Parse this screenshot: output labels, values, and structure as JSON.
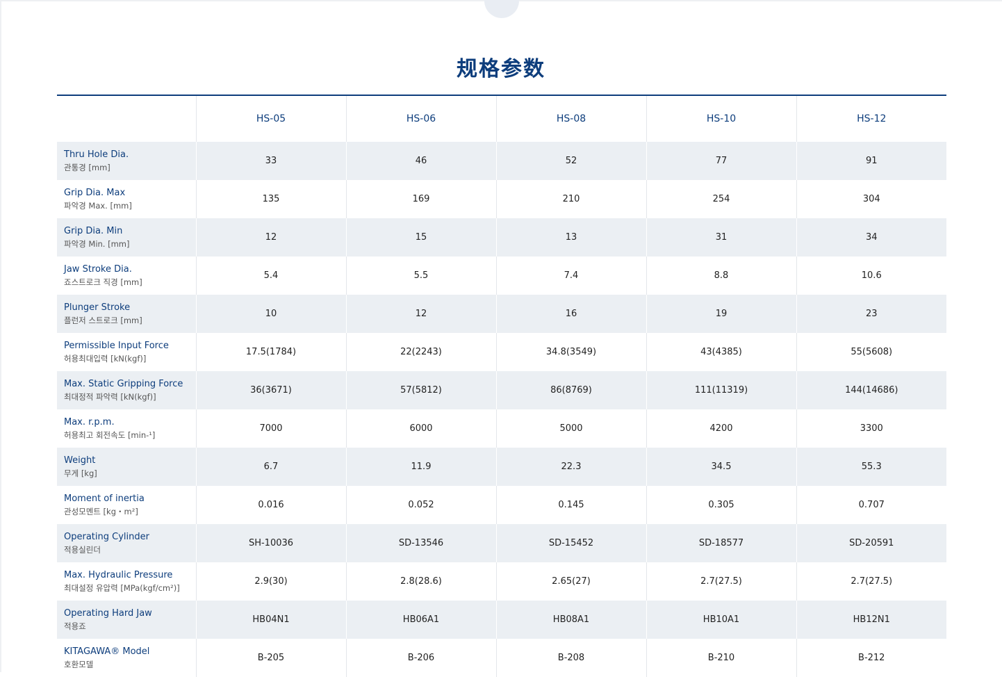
{
  "section": {
    "title": "规格参数"
  },
  "table": {
    "models": [
      "HS-05",
      "HS-06",
      "HS-08",
      "HS-10",
      "HS-12"
    ],
    "rows": [
      {
        "en": "Thru Hole Dia.",
        "ko": "관통경 [mm]",
        "values": [
          "33",
          "46",
          "52",
          "77",
          "91"
        ]
      },
      {
        "en": "Grip Dia. Max",
        "ko": "파악경 Max. [mm]",
        "values": [
          "135",
          "169",
          "210",
          "254",
          "304"
        ]
      },
      {
        "en": "Grip Dia. Min",
        "ko": "파악경 Min. [mm]",
        "values": [
          "12",
          "15",
          "13",
          "31",
          "34"
        ]
      },
      {
        "en": "Jaw Stroke Dia.",
        "ko": "죠스트로크 직경 [mm]",
        "values": [
          "5.4",
          "5.5",
          "7.4",
          "8.8",
          "10.6"
        ]
      },
      {
        "en": "Plunger Stroke",
        "ko": "플런저 스트로크 [mm]",
        "values": [
          "10",
          "12",
          "16",
          "19",
          "23"
        ]
      },
      {
        "en": "Permissible Input Force",
        "ko": "허용최대입력 [kN(kgf)]",
        "values": [
          "17.5(1784)",
          "22(2243)",
          "34.8(3549)",
          "43(4385)",
          "55(5608)"
        ]
      },
      {
        "en": "Max. Static Gripping Force",
        "ko": "최대정적 파악력 [kN(kgf)]",
        "values": [
          "36(3671)",
          "57(5812)",
          "86(8769)",
          "111(11319)",
          "144(14686)"
        ]
      },
      {
        "en": "Max. r.p.m.",
        "ko": "허용최고 회전속도 [min-¹]",
        "values": [
          "7000",
          "6000",
          "5000",
          "4200",
          "3300"
        ]
      },
      {
        "en": "Weight",
        "ko": "무게 [kg]",
        "values": [
          "6.7",
          "11.9",
          "22.3",
          "34.5",
          "55.3"
        ]
      },
      {
        "en": "Moment of inertia",
        "ko": "관성모멘트 [kg・m²]",
        "values": [
          "0.016",
          "0.052",
          "0.145",
          "0.305",
          "0.707"
        ]
      },
      {
        "en": "Operating Cylinder",
        "ko": "적용실린더",
        "values": [
          "SH-10036",
          "SD-13546",
          "SD-15452",
          "SD-18577",
          "SD-20591"
        ]
      },
      {
        "en": "Max. Hydraulic Pressure",
        "ko": "최대설정 유압력 [MPa(kgf/cm²)]",
        "values": [
          "2.9(30)",
          "2.8(28.6)",
          "2.65(27)",
          "2.7(27.5)",
          "2.7(27.5)"
        ]
      },
      {
        "en": "Operating Hard Jaw",
        "ko": "적용죠",
        "values": [
          "HB04N1",
          "HB06A1",
          "HB08A1",
          "HB10A1",
          "HB12N1"
        ]
      },
      {
        "en": "KITAGAWA® Model",
        "ko": "호환모델",
        "values": [
          "B-205",
          "B-206",
          "B-208",
          "B-210",
          "B-212"
        ]
      }
    ]
  }
}
